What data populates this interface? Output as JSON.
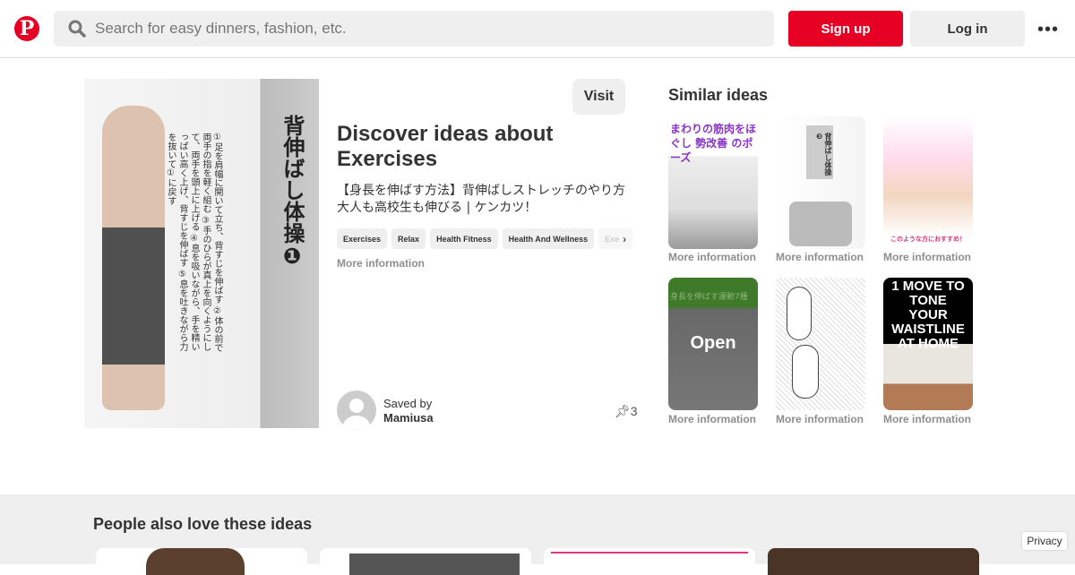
{
  "header": {
    "logo": "P",
    "search_placeholder": "Search for easy dinners, fashion, etc.",
    "signup": "Sign up",
    "login": "Log in",
    "more": "•••"
  },
  "pin": {
    "image_title": "背伸ばし体操❶",
    "image_text": "①足を肩幅に開いて立ち、背すじを伸ばす ②体の前で両手の指を軽く組む ③手のひらが真上を向くようにして、両手を頭上に上げる ④息を吸いながら、手を精いっぱい高く上げ、背すじを伸ばす ⑤息を吐きながら力を抜いて①に戻す",
    "visit": "Visit",
    "title": "Discover ideas about Exercises",
    "description": "【身長を伸ばす方法】背伸ばしストレッチのやり方 大人も高校生も伸びる | ケンカツ！",
    "tags": [
      "Exercises",
      "Relax",
      "Health Fitness",
      "Health And Wellness",
      "Exe"
    ],
    "more_info": "More information",
    "saved_by_label": "Saved by",
    "saved_by": "Mamiusa",
    "pin_count": "3"
  },
  "similar": {
    "heading": "Similar ideas",
    "items": [
      {
        "caption": "まわりの筋肉をほぐし 勢改善 のポーズ",
        "label": "More information"
      },
      {
        "caption": "背伸ばし体操❸",
        "label": "More information"
      },
      {
        "caption": "このような方におすすめ！",
        "label": "More information"
      },
      {
        "caption": "身長を伸ばす運動7種",
        "overlay": "Open",
        "label": "More information"
      },
      {
        "caption": "",
        "label": "More information"
      },
      {
        "caption": "1 MOVE TO TONE YOUR WAISTLINE AT HOME",
        "label": "More information"
      }
    ]
  },
  "people_also_love": {
    "heading": "People also love these ideas"
  },
  "privacy": "Privacy"
}
